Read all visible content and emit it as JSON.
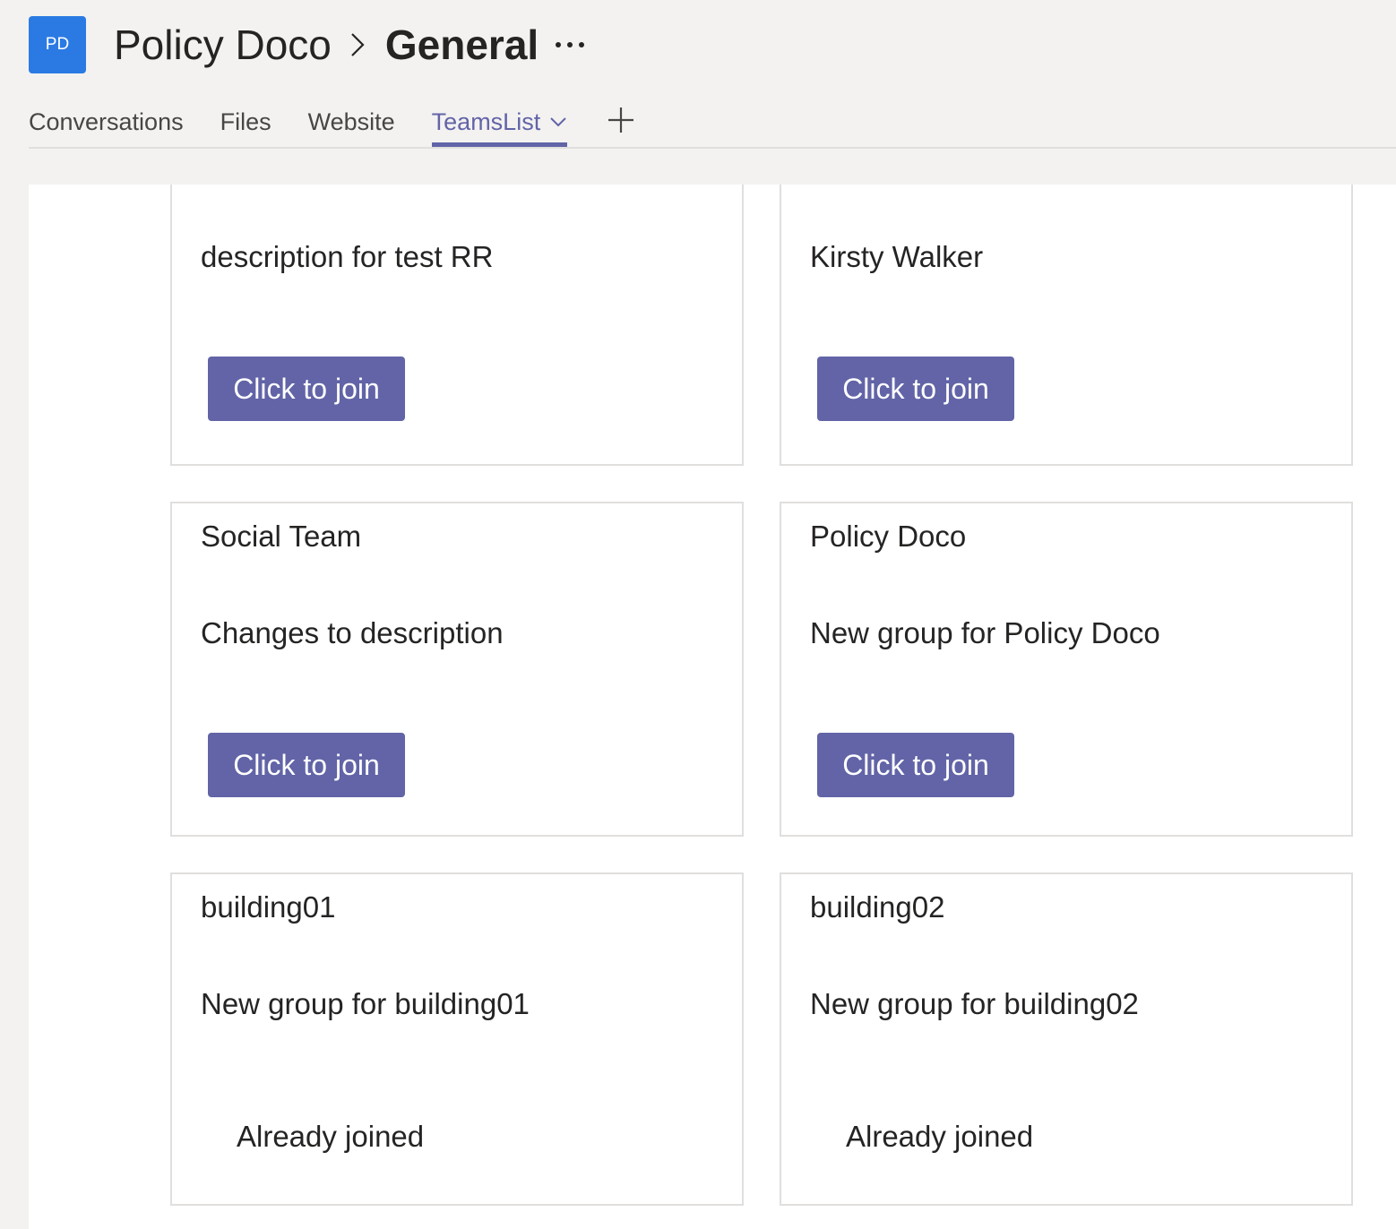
{
  "header": {
    "avatar_initials": "PD",
    "team_name": "Policy Doco",
    "channel_name": "General"
  },
  "tabs": [
    {
      "label": "Conversations"
    },
    {
      "label": "Files"
    },
    {
      "label": "Website"
    },
    {
      "label": "TeamsList",
      "active": true
    }
  ],
  "colors": {
    "accent": "#6264a7",
    "avatar": "#2b7ae4",
    "header_bg": "#f3f2f1",
    "content_bg": "#ffffff",
    "card_border": "#e1dfdd"
  },
  "icons": {
    "breadcrumb_separator": "chevron-right-icon",
    "more": "more-horizontal-icon",
    "tab_dropdown": "chevron-down-icon",
    "add_tab": "plus-icon"
  },
  "cards": [
    {
      "title": "",
      "description": "description for test RR",
      "action": "Click to join"
    },
    {
      "title": "",
      "description": "Kirsty Walker",
      "action": "Click to join"
    },
    {
      "title": "Social Team",
      "description": "Changes to description",
      "action": "Click to join"
    },
    {
      "title": "Policy Doco",
      "description": "New group for Policy Doco",
      "action": "Click to join"
    },
    {
      "title": "building01",
      "description": "New group for building01",
      "status": "Already joined"
    },
    {
      "title": "building02",
      "description": "New group for building02",
      "status": "Already joined"
    }
  ]
}
